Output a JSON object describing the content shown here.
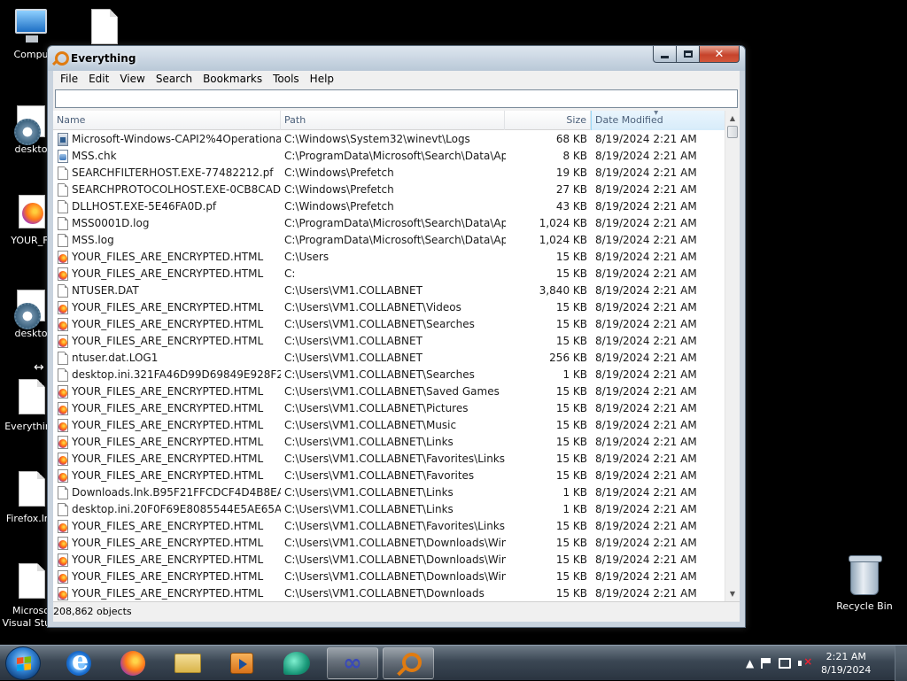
{
  "desktop": {
    "icons": [
      {
        "label": "Compu"
      },
      {
        "label": ""
      },
      {
        "label": "deskto"
      },
      {
        "label": "YOUR_FI"
      },
      {
        "label": "deskto"
      },
      {
        "label": "Everything"
      },
      {
        "label": "Firefox.lnk"
      },
      {
        "label": "Microso"
      },
      {
        "label": "Visual Stu..."
      }
    ],
    "recycle_bin_label": "Recycle Bin"
  },
  "window": {
    "title": "Everything",
    "menu": [
      "File",
      "Edit",
      "View",
      "Search",
      "Bookmarks",
      "Tools",
      "Help"
    ],
    "search": {
      "value": "",
      "placeholder": ""
    },
    "columns": {
      "name": "Name",
      "path": "Path",
      "size": "Size",
      "date": "Date Modified"
    },
    "sorted_column": "Date Modified",
    "rows": [
      {
        "icon": "evtx",
        "name": "Microsoft-Windows-CAPI2%4Operational...",
        "path": "C:\\Windows\\System32\\winevt\\Logs",
        "size": "68 KB",
        "date": "8/19/2024 2:21 AM"
      },
      {
        "icon": "chk",
        "name": "MSS.chk",
        "path": "C:\\ProgramData\\Microsoft\\Search\\Data\\App...",
        "size": "8 KB",
        "date": "8/19/2024 2:21 AM"
      },
      {
        "icon": "plain",
        "name": "SEARCHFILTERHOST.EXE-77482212.pf",
        "path": "C:\\Windows\\Prefetch",
        "size": "19 KB",
        "date": "8/19/2024 2:21 AM"
      },
      {
        "icon": "plain",
        "name": "SEARCHPROTOCOLHOST.EXE-0CB8CADE...",
        "path": "C:\\Windows\\Prefetch",
        "size": "27 KB",
        "date": "8/19/2024 2:21 AM"
      },
      {
        "icon": "plain",
        "name": "DLLHOST.EXE-5E46FA0D.pf",
        "path": "C:\\Windows\\Prefetch",
        "size": "43 KB",
        "date": "8/19/2024 2:21 AM"
      },
      {
        "icon": "plain",
        "name": "MSS0001D.log",
        "path": "C:\\ProgramData\\Microsoft\\Search\\Data\\App...",
        "size": "1,024 KB",
        "date": "8/19/2024 2:21 AM"
      },
      {
        "icon": "plain",
        "name": "MSS.log",
        "path": "C:\\ProgramData\\Microsoft\\Search\\Data\\App...",
        "size": "1,024 KB",
        "date": "8/19/2024 2:21 AM"
      },
      {
        "icon": "html",
        "name": "YOUR_FILES_ARE_ENCRYPTED.HTML",
        "path": "C:\\Users",
        "size": "15 KB",
        "date": "8/19/2024 2:21 AM"
      },
      {
        "icon": "html",
        "name": "YOUR_FILES_ARE_ENCRYPTED.HTML",
        "path": "C:",
        "size": "15 KB",
        "date": "8/19/2024 2:21 AM"
      },
      {
        "icon": "plain",
        "name": "NTUSER.DAT",
        "path": "C:\\Users\\VM1.COLLABNET",
        "size": "3,840 KB",
        "date": "8/19/2024 2:21 AM"
      },
      {
        "icon": "html",
        "name": "YOUR_FILES_ARE_ENCRYPTED.HTML",
        "path": "C:\\Users\\VM1.COLLABNET\\Videos",
        "size": "15 KB",
        "date": "8/19/2024 2:21 AM"
      },
      {
        "icon": "html",
        "name": "YOUR_FILES_ARE_ENCRYPTED.HTML",
        "path": "C:\\Users\\VM1.COLLABNET\\Searches",
        "size": "15 KB",
        "date": "8/19/2024 2:21 AM"
      },
      {
        "icon": "html",
        "name": "YOUR_FILES_ARE_ENCRYPTED.HTML",
        "path": "C:\\Users\\VM1.COLLABNET",
        "size": "15 KB",
        "date": "8/19/2024 2:21 AM"
      },
      {
        "icon": "plain",
        "name": "ntuser.dat.LOG1",
        "path": "C:\\Users\\VM1.COLLABNET",
        "size": "256 KB",
        "date": "8/19/2024 2:21 AM"
      },
      {
        "icon": "plain",
        "name": "desktop.ini.321FA46D99D69849E928F21608...",
        "path": "C:\\Users\\VM1.COLLABNET\\Searches",
        "size": "1 KB",
        "date": "8/19/2024 2:21 AM"
      },
      {
        "icon": "html",
        "name": "YOUR_FILES_ARE_ENCRYPTED.HTML",
        "path": "C:\\Users\\VM1.COLLABNET\\Saved Games",
        "size": "15 KB",
        "date": "8/19/2024 2:21 AM"
      },
      {
        "icon": "html",
        "name": "YOUR_FILES_ARE_ENCRYPTED.HTML",
        "path": "C:\\Users\\VM1.COLLABNET\\Pictures",
        "size": "15 KB",
        "date": "8/19/2024 2:21 AM"
      },
      {
        "icon": "html",
        "name": "YOUR_FILES_ARE_ENCRYPTED.HTML",
        "path": "C:\\Users\\VM1.COLLABNET\\Music",
        "size": "15 KB",
        "date": "8/19/2024 2:21 AM"
      },
      {
        "icon": "html",
        "name": "YOUR_FILES_ARE_ENCRYPTED.HTML",
        "path": "C:\\Users\\VM1.COLLABNET\\Links",
        "size": "15 KB",
        "date": "8/19/2024 2:21 AM"
      },
      {
        "icon": "html",
        "name": "YOUR_FILES_ARE_ENCRYPTED.HTML",
        "path": "C:\\Users\\VM1.COLLABNET\\Favorites\\Links f...",
        "size": "15 KB",
        "date": "8/19/2024 2:21 AM"
      },
      {
        "icon": "html",
        "name": "YOUR_FILES_ARE_ENCRYPTED.HTML",
        "path": "C:\\Users\\VM1.COLLABNET\\Favorites",
        "size": "15 KB",
        "date": "8/19/2024 2:21 AM"
      },
      {
        "icon": "plain",
        "name": "Downloads.lnk.B95F21FFCDCF4D4B8EAE2...",
        "path": "C:\\Users\\VM1.COLLABNET\\Links",
        "size": "1 KB",
        "date": "8/19/2024 2:21 AM"
      },
      {
        "icon": "plain",
        "name": "desktop.ini.20F0F69E8085544E5AE65A8810...",
        "path": "C:\\Users\\VM1.COLLABNET\\Links",
        "size": "1 KB",
        "date": "8/19/2024 2:21 AM"
      },
      {
        "icon": "html",
        "name": "YOUR_FILES_ARE_ENCRYPTED.HTML",
        "path": "C:\\Users\\VM1.COLLABNET\\Favorites\\Links",
        "size": "15 KB",
        "date": "8/19/2024 2:21 AM"
      },
      {
        "icon": "html",
        "name": "YOUR_FILES_ARE_ENCRYPTED.HTML",
        "path": "C:\\Users\\VM1.COLLABNET\\Downloads\\Wind...",
        "size": "15 KB",
        "date": "8/19/2024 2:21 AM"
      },
      {
        "icon": "html",
        "name": "YOUR_FILES_ARE_ENCRYPTED.HTML",
        "path": "C:\\Users\\VM1.COLLABNET\\Downloads\\Wind...",
        "size": "15 KB",
        "date": "8/19/2024 2:21 AM"
      },
      {
        "icon": "html",
        "name": "YOUR_FILES_ARE_ENCRYPTED.HTML",
        "path": "C:\\Users\\VM1.COLLABNET\\Downloads\\Wind...",
        "size": "15 KB",
        "date": "8/19/2024 2:21 AM"
      },
      {
        "icon": "html",
        "name": "YOUR_FILES_ARE_ENCRYPTED.HTML",
        "path": "C:\\Users\\VM1.COLLABNET\\Downloads",
        "size": "15 KB",
        "date": "8/19/2024 2:21 AM"
      }
    ],
    "status": "208,862 objects"
  },
  "taskbar": {
    "apps": [
      "internet-explorer",
      "firefox",
      "windows-explorer",
      "media-player",
      "chat-app",
      "infinity-app",
      "everything"
    ],
    "active_app": "everything",
    "clock": {
      "time": "2:21 AM",
      "date": "8/19/2024"
    }
  },
  "colors": {
    "desktop_background": "#000000",
    "sorted_header": "#d7ecfa",
    "close_button": "#c6432b"
  }
}
